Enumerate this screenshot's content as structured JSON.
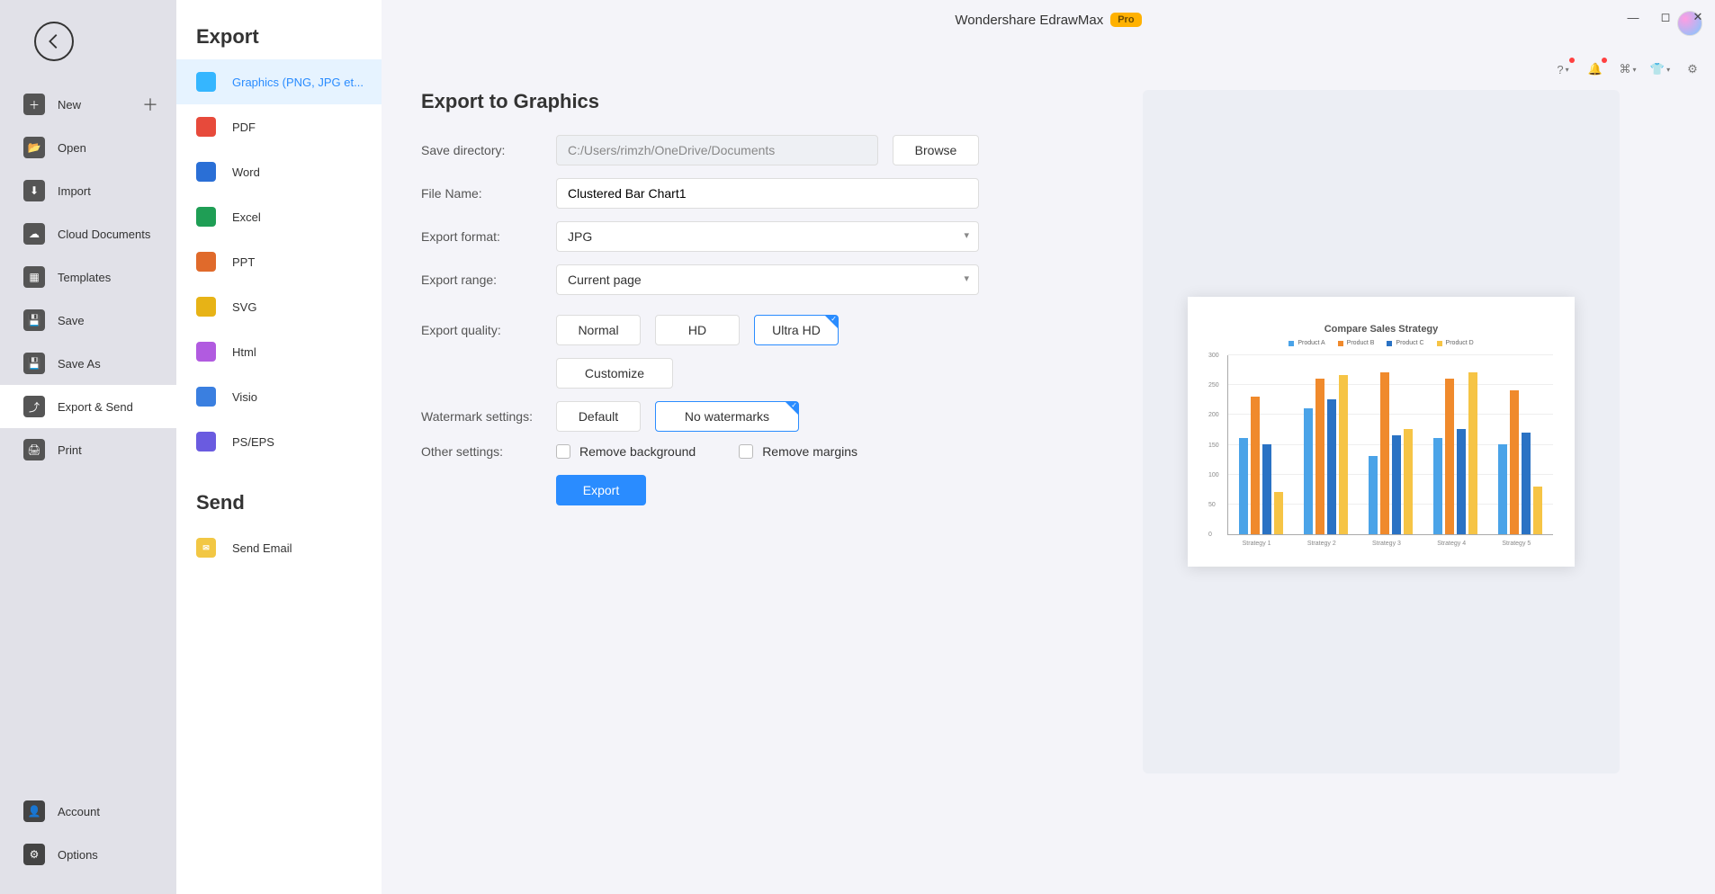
{
  "app_title": "Wondershare EdrawMax",
  "pro_badge": "Pro",
  "sidebar": {
    "items": [
      {
        "label": "New",
        "has_plus": true
      },
      {
        "label": "Open"
      },
      {
        "label": "Import"
      },
      {
        "label": "Cloud Documents"
      },
      {
        "label": "Templates"
      },
      {
        "label": "Save"
      },
      {
        "label": "Save As"
      },
      {
        "label": "Export & Send",
        "active": true
      },
      {
        "label": "Print"
      }
    ],
    "bottom": [
      {
        "label": "Account"
      },
      {
        "label": "Options"
      }
    ]
  },
  "export_panel": {
    "section_export": "Export",
    "section_send": "Send",
    "formats": [
      {
        "label": "Graphics (PNG, JPG et...",
        "color": "#35b6ff",
        "active": true
      },
      {
        "label": "PDF",
        "color": "#e74a3b"
      },
      {
        "label": "Word",
        "color": "#2a6fd6"
      },
      {
        "label": "Excel",
        "color": "#1f9e55"
      },
      {
        "label": "PPT",
        "color": "#e06a2b"
      },
      {
        "label": "SVG",
        "color": "#e7b316"
      },
      {
        "label": "Html",
        "color": "#b15be0"
      },
      {
        "label": "Visio",
        "color": "#3a7fe0"
      },
      {
        "label": "PS/EPS",
        "color": "#6a5be0"
      }
    ],
    "send_items": [
      {
        "label": "Send Email",
        "color": "#f2c744"
      }
    ]
  },
  "form": {
    "heading": "Export to Graphics",
    "labels": {
      "save_dir": "Save directory:",
      "file_name": "File Name:",
      "format": "Export format:",
      "range": "Export range:",
      "quality": "Export quality:",
      "watermark": "Watermark settings:",
      "other": "Other settings:"
    },
    "save_dir_value": "C:/Users/rimzh/OneDrive/Documents",
    "browse": "Browse",
    "file_name_value": "Clustered Bar Chart1",
    "format_value": "JPG",
    "range_value": "Current page",
    "quality_options": {
      "normal": "Normal",
      "hd": "HD",
      "uhd": "Ultra HD"
    },
    "customize": "Customize",
    "watermark_options": {
      "default": "Default",
      "none": "No watermarks"
    },
    "remove_bg": "Remove background",
    "remove_margins": "Remove margins",
    "export_btn": "Export"
  },
  "chart_data": {
    "type": "bar",
    "title": "Compare Sales Strategy",
    "categories": [
      "Strategy 1",
      "Strategy 2",
      "Strategy 3",
      "Strategy 4",
      "Strategy 5"
    ],
    "series": [
      {
        "name": "Product A",
        "color": "#4aa3e8",
        "values": [
          160,
          210,
          130,
          160,
          150
        ]
      },
      {
        "name": "Product B",
        "color": "#f08a2c",
        "values": [
          230,
          260,
          270,
          260,
          240
        ]
      },
      {
        "name": "Product C",
        "color": "#2a72c4",
        "values": [
          150,
          225,
          165,
          175,
          170
        ]
      },
      {
        "name": "Product D",
        "color": "#f6c445",
        "values": [
          70,
          265,
          175,
          270,
          80
        ]
      }
    ],
    "ylim": [
      0,
      300
    ],
    "yticks": [
      0,
      50,
      100,
      150,
      200,
      250,
      300
    ],
    "xlabel": "",
    "ylabel": ""
  }
}
